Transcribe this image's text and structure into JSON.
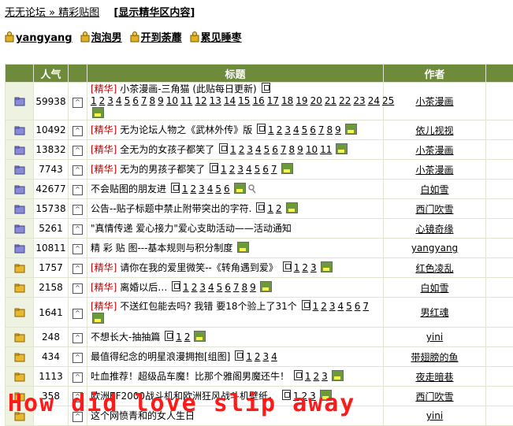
{
  "topbar": {
    "breadcrumb": "无无论坛 » 精彩贴图",
    "toggle_label": "显示精华区内容"
  },
  "moderators": [
    "yangyang",
    "泡泡男",
    "开到荼蘼",
    "累见睡枣"
  ],
  "table": {
    "headers": [
      "人气",
      "标题",
      "作者"
    ],
    "rows": [
      {
        "pop": "59938",
        "tag": "[精华]",
        "title": "小茶漫画-三角猫 (此贴每日更新)",
        "pages": [
          "1",
          "2",
          "3",
          "4",
          "5",
          "6",
          "7",
          "8",
          "9",
          "10",
          "11",
          "12",
          "13",
          "14",
          "15",
          "16",
          "17",
          "18",
          "19",
          "20",
          "21",
          "22",
          "23",
          "24",
          "25"
        ],
        "img": true,
        "lock": false,
        "author": "小茶漫画",
        "folder": "purple",
        "tall": true
      },
      {
        "pop": "10492",
        "tag": "[精华]",
        "title": "无为论坛人物之《武林外传》版",
        "pages": [
          "1",
          "2",
          "3",
          "4",
          "5",
          "6",
          "7",
          "8",
          "9"
        ],
        "img": true,
        "lock": false,
        "author": "依儿视视",
        "folder": "purple",
        "tall": false
      },
      {
        "pop": "13832",
        "tag": "[精华]",
        "title": "全无为的女孩子都笑了",
        "pages": [
          "1",
          "2",
          "3",
          "4",
          "5",
          "6",
          "7",
          "8",
          "9",
          "10",
          "11"
        ],
        "img": true,
        "lock": false,
        "author": "小茶漫画",
        "folder": "purple",
        "tall": false
      },
      {
        "pop": "7743",
        "tag": "[精华]",
        "title": "无为的男孩子都笑了",
        "pages": [
          "1",
          "2",
          "3",
          "4",
          "5",
          "6",
          "7"
        ],
        "img": true,
        "lock": false,
        "author": "小茶漫画",
        "folder": "purple",
        "tall": false
      },
      {
        "pop": "42677",
        "tag": "",
        "title": "不会贴图的朋友进",
        "pages": [
          "1",
          "2",
          "3",
          "4",
          "5",
          "6"
        ],
        "img": true,
        "lock": true,
        "author": "白如雪",
        "folder": "purple",
        "tall": false
      },
      {
        "pop": "15738",
        "tag": "",
        "title": "公告--贴子标题中禁止附带突出的字符.",
        "pages": [
          "1",
          "2"
        ],
        "img": true,
        "lock": false,
        "author": "西门吹雪",
        "folder": "purple",
        "tall": false
      },
      {
        "pop": "5261",
        "tag": "",
        "title": "\"真情传递 爱心接力\"爱心支助活动——活动通知",
        "pages": [],
        "img": false,
        "lock": false,
        "author": "心镜奇缘",
        "folder": "purple",
        "tall": false
      },
      {
        "pop": "10811",
        "tag": "",
        "title": "精 彩 贴 图---基本规则与积分制度",
        "pages": [],
        "img": true,
        "lock": false,
        "author": "yangyang",
        "folder": "purple",
        "tall": false
      },
      {
        "pop": "1757",
        "tag": "[精华]",
        "title": "请你在我的爱里微笑--《转角遇到爱》",
        "pages": [
          "1",
          "2",
          "3"
        ],
        "img": true,
        "lock": false,
        "author": "红色凌乱",
        "folder": "gold",
        "tall": false
      },
      {
        "pop": "2158",
        "tag": "[精华]",
        "title": "离婚以后…",
        "pages": [
          "1",
          "2",
          "3",
          "4",
          "5",
          "6",
          "7",
          "8",
          "9"
        ],
        "img": true,
        "lock": false,
        "author": "白如雪",
        "folder": "gold",
        "tall": false
      },
      {
        "pop": "1641",
        "tag": "[精华]",
        "title": "不送红包能去吗? 我错 要18个验上了31个",
        "pages": [
          "1",
          "2",
          "3",
          "4",
          "5",
          "6",
          "7"
        ],
        "img": true,
        "lock": false,
        "author": "男红魂",
        "folder": "gold",
        "tall": true
      },
      {
        "pop": "248",
        "tag": "",
        "title": "不想长大-抽抽篇",
        "pages": [
          "1",
          "2"
        ],
        "img": true,
        "lock": false,
        "author": "yini",
        "folder": "gold",
        "tall": false
      },
      {
        "pop": "434",
        "tag": "",
        "title": "最值得纪念的明星浪漫拥抱[组图]",
        "pages": [
          "1",
          "2",
          "3",
          "4"
        ],
        "img": false,
        "lock": false,
        "author": "带翅膀的鱼",
        "folder": "gold",
        "tall": false
      },
      {
        "pop": "1113",
        "tag": "",
        "title": "吐血推荐！超级品车魔！比那个雅阁男魔还牛！",
        "pages": [
          "1",
          "2",
          "3"
        ],
        "img": true,
        "lock": false,
        "author": "夜走暗巷",
        "folder": "gold",
        "tall": false
      },
      {
        "pop": "358",
        "tag": "",
        "title": "欧洲EF2000战斗机和欧洲狂风战斗机壁纸，",
        "pages": [
          "1",
          "2",
          "3"
        ],
        "img": true,
        "lock": false,
        "author": "西门吹雪",
        "folder": "gold",
        "tall": false
      },
      {
        "pop": "",
        "tag": "",
        "title": "这个网愤青和的女人生日",
        "pages": [],
        "img": false,
        "lock": false,
        "author": "yini",
        "folder": "gold",
        "tall": false
      }
    ]
  },
  "watermark": "How did love slip away",
  "colors": {
    "header_bg": "#6d8b3a",
    "tag": "#c00000",
    "watermark": "#ff1a1a"
  }
}
